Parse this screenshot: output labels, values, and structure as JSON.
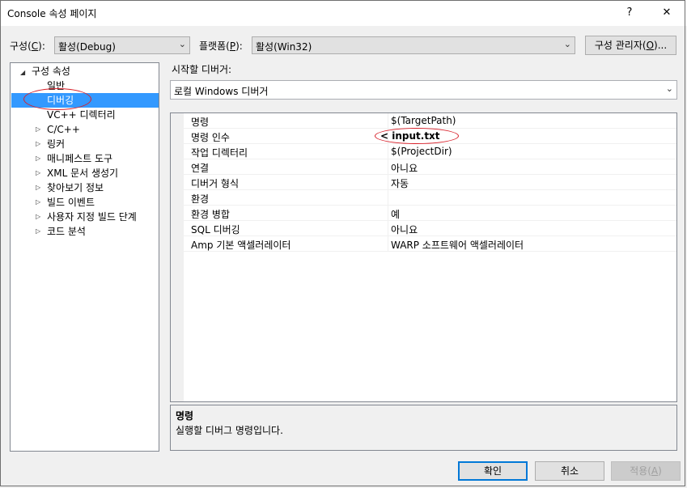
{
  "window": {
    "title": "Console 속성 페이지",
    "help": "?",
    "close": "✕"
  },
  "top": {
    "config_label_pre": "구성(",
    "config_label_key": "C",
    "config_label_post": "):",
    "config_value": "활성(Debug)",
    "platform_label_pre": "플랫폼(",
    "platform_label_key": "P",
    "platform_label_post": "):",
    "platform_value": "활성(Win32)",
    "config_manager_pre": "구성 관리자(",
    "config_manager_key": "O",
    "config_manager_post": ")..."
  },
  "tree": {
    "root": "구성 속성",
    "items": [
      {
        "label": "일반"
      },
      {
        "label": "디버깅"
      },
      {
        "label": "VC++ 디렉터리"
      },
      {
        "label": "C/C++"
      },
      {
        "label": "링커"
      },
      {
        "label": "매니페스트 도구"
      },
      {
        "label": "XML 문서 생성기"
      },
      {
        "label": "찾아보기 정보"
      },
      {
        "label": "빌드 이벤트"
      },
      {
        "label": "사용자 지정 빌드 단계"
      },
      {
        "label": "코드 분석"
      }
    ]
  },
  "debugger": {
    "label": "시작할 디버거:",
    "value": "로컬 Windows 디버거"
  },
  "grid": {
    "rows": [
      {
        "name": "명령",
        "value": "$(TargetPath)"
      },
      {
        "name": "명령 인수",
        "value": "< input.txt"
      },
      {
        "name": "작업 디렉터리",
        "value": "$(ProjectDir)"
      },
      {
        "name": "연결",
        "value": "아니요"
      },
      {
        "name": "디버거 형식",
        "value": "자동"
      },
      {
        "name": "환경",
        "value": ""
      },
      {
        "name": "환경 병합",
        "value": "예"
      },
      {
        "name": "SQL 디버깅",
        "value": "아니요"
      },
      {
        "name": "Amp 기본 액셀러레이터",
        "value": "WARP 소프트웨어 액셀러레이터"
      }
    ]
  },
  "description": {
    "title": "명령",
    "text": "실행할 디버그 명령입니다."
  },
  "buttons": {
    "ok": "확인",
    "cancel": "취소",
    "apply_pre": "적용(",
    "apply_key": "A",
    "apply_post": ")"
  },
  "colors": {
    "selection": "#3399ff",
    "annotation": "#d8202a",
    "accent": "#0078d7"
  }
}
